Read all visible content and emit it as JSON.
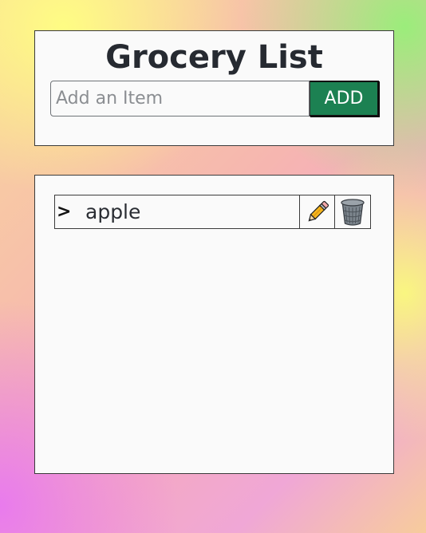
{
  "header": {
    "title": "Grocery List",
    "input_placeholder": "Add an Item",
    "input_value": "",
    "add_label": "ADD"
  },
  "list": {
    "items": [
      {
        "expand_marker": ">",
        "label": "apple",
        "edit_icon": "pencil-icon",
        "delete_icon": "trash-can-icon"
      }
    ]
  },
  "colors": {
    "add_button": "#1c8152",
    "card_background": "#fafafa",
    "text": "#262a31"
  }
}
